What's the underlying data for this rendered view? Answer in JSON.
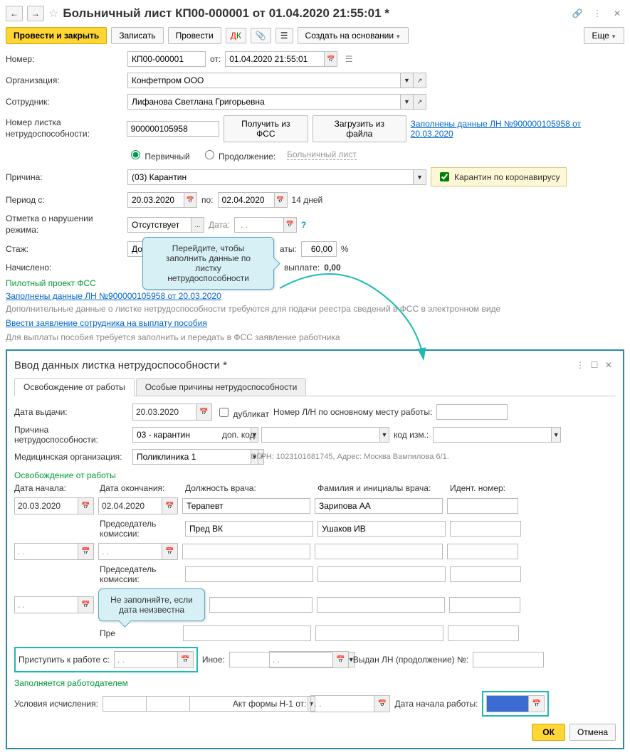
{
  "title": "Больничный лист КП00-000001 от 01.04.2020 21:55:01 *",
  "toolbar": {
    "post_close": "Провести и закрыть",
    "save": "Записать",
    "post": "Провести",
    "create_based": "Создать на основании",
    "more": "Еще"
  },
  "form": {
    "number_lbl": "Номер:",
    "number_val": "КП00-000001",
    "date_lbl": "от:",
    "date_val": "01.04.2020 21:55:01",
    "org_lbl": "Организация:",
    "org_val": "Конфетпром ООО",
    "emp_lbl": "Сотрудник:",
    "emp_val": "Лифанова Светлана Григорьевна",
    "ln_num_lbl": "Номер листка нетрудоспособности:",
    "ln_num_val": "900000105958",
    "get_fss": "Получить из ФСС",
    "load_file": "Загрузить из файла",
    "ln_link": "Заполнены данные ЛН №900000105958 от 20.03.2020",
    "primary": "Первичный",
    "continuation": "Продолжение:",
    "cont_link": "Больничный лист",
    "reason_lbl": "Причина:",
    "reason_val": "(03) Карантин",
    "covid_chk": "Карантин по коронавирусу",
    "period_lbl": "Период с:",
    "period_from": "20.03.2020",
    "period_to_lbl": "по:",
    "period_to": "02.04.2020",
    "days": "14 дней",
    "violation_lbl": "Отметка о нарушении режима:",
    "violation_val": "Отсутствует",
    "vio_date_lbl": "Дата:",
    "exp_lbl": "Стаж:",
    "exp_val": "До 5",
    "pay_pct_lbl": "аты:",
    "pay_pct_val": "60,00",
    "accrued_lbl": "Начислено:",
    "pay_lbl": "выплате:",
    "pay_val": "0,00",
    "pilot_hdr": "Пилотный проект ФСС",
    "ln_link2": "Заполнены данные ЛН №900000105958 от 20.03.2020",
    "addl_txt": "Дополнительные данные о листке нетрудоспособности требуются для подачи реестра сведений в ФСС в электронном виде",
    "app_link": "Ввести заявление сотрудника на выплату пособия",
    "app_txt": "Для выплаты пособия требуется заполнить и передать в ФСС заявление работника"
  },
  "tip1_l1": "Перейдите, чтобы",
  "tip1_l2": "заполнить данные по листку",
  "tip1_l3": "нетрудоспособности",
  "tip2_l1": "Не заполняйте, если",
  "tip2_l2": "дата неизвестна",
  "sub": {
    "title": "Ввод данных листка нетрудоспособности *",
    "tab1": "Освобождение от работы",
    "tab2": "Особые причины нетрудоспособности",
    "issue_date_lbl": "Дата выдачи:",
    "issue_date_val": "20.03.2020",
    "dup_lbl": "дубликат",
    "main_ln_lbl": "Номер Л/Н по основному месту работы:",
    "reason_lbl": "Причина нетрудоспособности:",
    "reason_val": "03 - карантин",
    "add_code_lbl": "доп. код:",
    "code_chg_lbl": "код изм.:",
    "med_org_lbl": "Медицинская организация:",
    "med_org_val": "Поликлиника 1",
    "ogrn": "ОГРН: 1023101681745, Адрес: Москва Вампилова 6/1.",
    "release_hdr": "Освобождение от работы",
    "start_lbl": "Дата начала:",
    "end_lbl": "Дата окончания:",
    "doc_pos_lbl": "Должность врача:",
    "doc_name_lbl": "Фамилия и инициалы врача:",
    "id_lbl": "Идент. номер:",
    "start_val": "20.03.2020",
    "end_val": "02.04.2020",
    "doc_pos_val": "Терапевт",
    "doc_name_val": "Зарипова АА",
    "chair_lbl": "Председатель комиссии:",
    "chair_pos": "Пред ВК",
    "chair_name": "Ушаков ИВ",
    "chair_lbl2": "Председатель комиссии:",
    "chair_pre": "Пре",
    "return_lbl": "Приступить к работе с:",
    "other_lbl": "Иное:",
    "issued_ln_lbl": "Выдан ЛН (продолжение) №:",
    "employer_hdr": "Заполняется работодателем",
    "calc_cond_lbl": "Условия исчисления:",
    "act_lbl": "Акт формы Н-1 от:",
    "work_start_lbl": "Дата начала работы:",
    "ok": "ОК",
    "cancel": "Отмена"
  }
}
